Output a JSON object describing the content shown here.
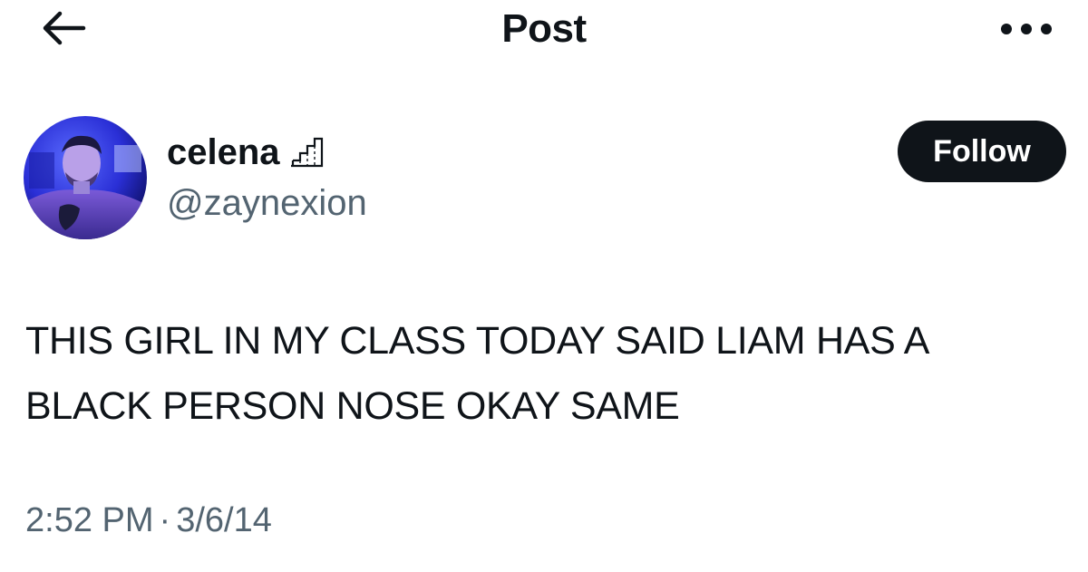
{
  "header": {
    "title": "Post",
    "back_icon": "arrow-left-icon",
    "more_icon": "more-horizontal-icon"
  },
  "author": {
    "display_name": "celena",
    "handle": "@zaynexion",
    "name_icon": "stairs-icon",
    "avatar_icon": "avatar-photo",
    "follow_label": "Follow"
  },
  "post": {
    "line1": "THIS GIRL IN MY CLASS TODAY SAID LIAM HAS A",
    "line2": "BLACK PERSON NOSE OKAY SAME"
  },
  "meta": {
    "time": "2:52 PM",
    "separator": "·",
    "date": "3/6/14"
  },
  "colors": {
    "text_primary": "#0f1419",
    "text_secondary": "#536471",
    "follow_bg": "#0f1419",
    "follow_text": "#ffffff",
    "avatar_glow": "#3a3cff"
  }
}
